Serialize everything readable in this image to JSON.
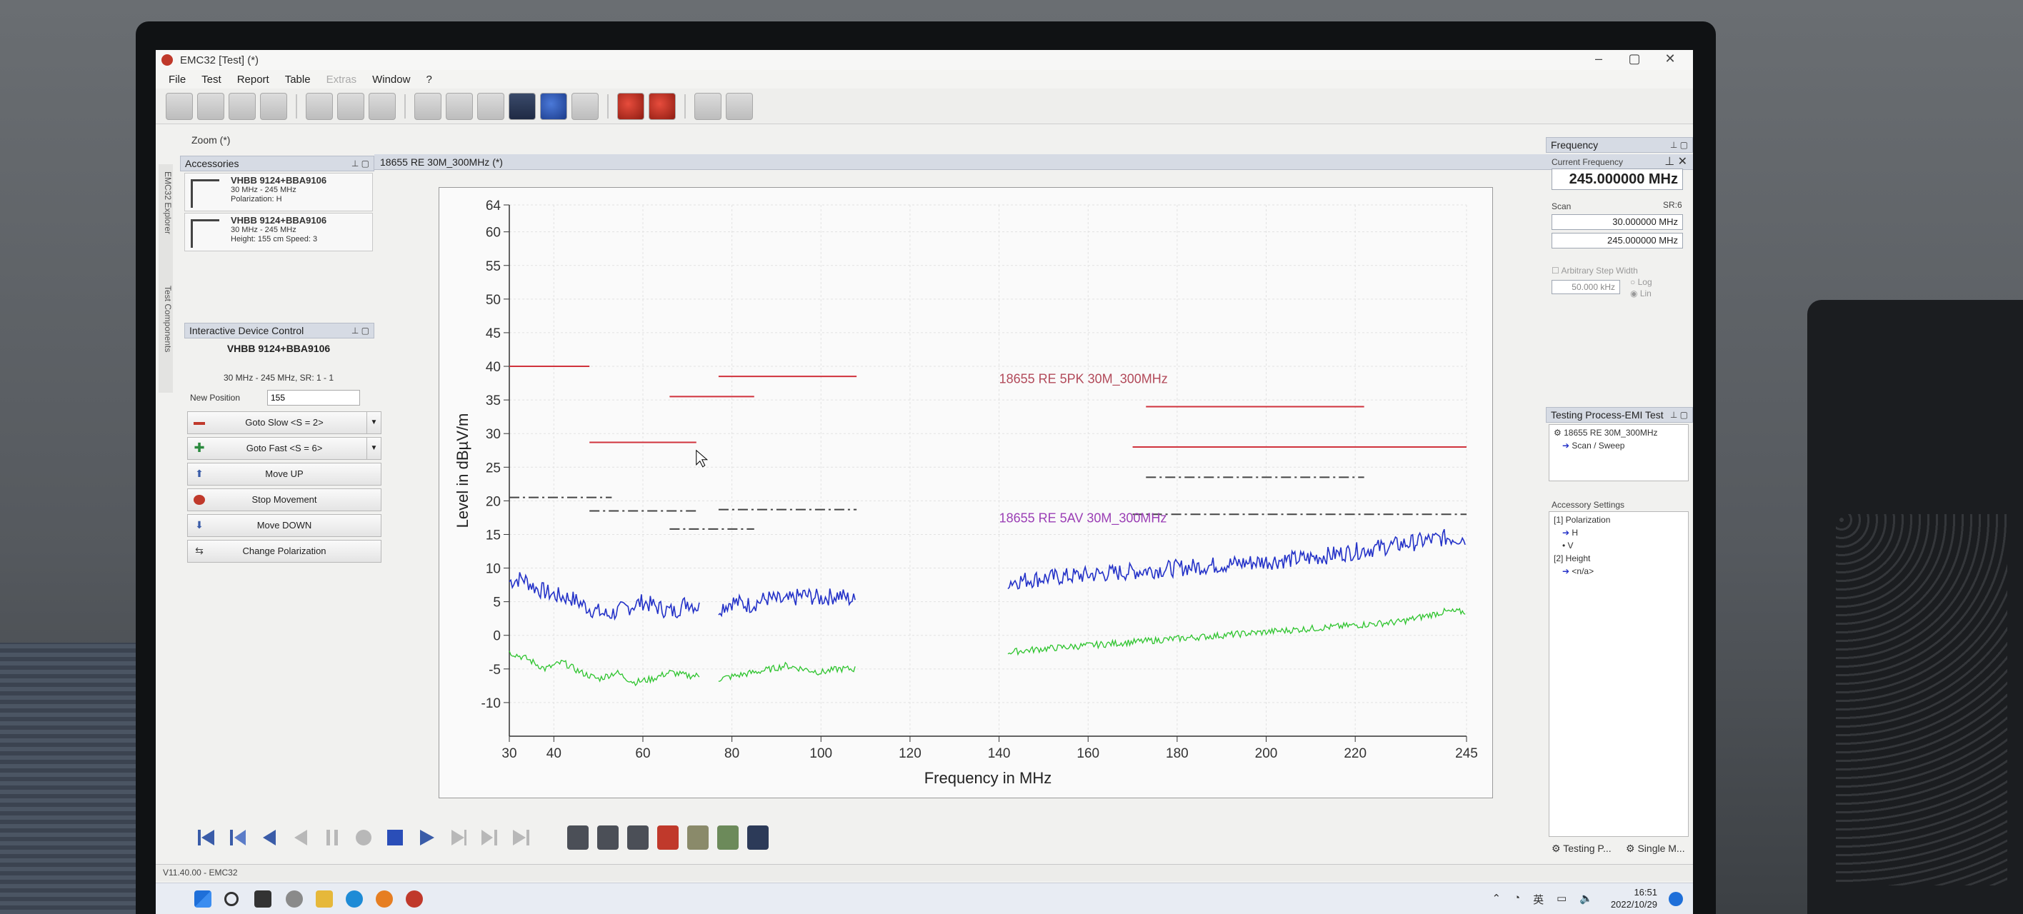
{
  "window": {
    "title": "EMC32 [Test] (*)",
    "menu": [
      "File",
      "Test",
      "Report",
      "Table",
      "Extras",
      "Window",
      "?"
    ]
  },
  "left": {
    "zoom_label": "Zoom (*)",
    "accessories_header": "Accessories",
    "accessories": [
      {
        "name": "VHBB 9124+BBA9106",
        "range": "30 MHz - 245 MHz",
        "detail": "Polarization: H"
      },
      {
        "name": "VHBB 9124+BBA9106",
        "range": "30 MHz - 245 MHz",
        "detail": "Height: 155 cm Speed: 3"
      }
    ],
    "vertical_tabs": [
      "EMC32 Explorer",
      "Test Components"
    ],
    "idc": {
      "header": "Interactive Device Control",
      "device": "VHBB 9124+BBA9106",
      "range": "30 MHz - 245 MHz, SR: 1 - 1",
      "position_label": "New Position",
      "position_value": "155",
      "buttons": [
        "Goto Slow <S = 2>",
        "Goto Fast <S = 6>",
        "Move UP",
        "Stop Movement",
        "Move DOWN",
        "Change Polarization"
      ]
    }
  },
  "doc": {
    "tab_title": "18655 RE 30M_300MHz (*)"
  },
  "chart_data": {
    "type": "line",
    "xlabel": "Frequency in MHz",
    "ylabel": "Level in dBµV/m",
    "xlim": [
      30,
      245
    ],
    "ylim": [
      -15,
      64
    ],
    "x_ticks": [
      30,
      40,
      60,
      80,
      100,
      120,
      140,
      160,
      180,
      200,
      220,
      245
    ],
    "y_ticks": [
      64,
      60,
      55,
      50,
      45,
      40,
      35,
      30,
      25,
      20,
      15,
      10,
      5,
      0,
      -5,
      -10
    ],
    "annotations": [
      "18655 RE 5PK 30M_300MHz",
      "18655 RE 5AV 30M_300MHz"
    ],
    "limit_lines": [
      {
        "style": "solid",
        "color": "#d0323c",
        "segments": [
          [
            30,
            48,
            40
          ],
          [
            48,
            72,
            28.7
          ],
          [
            66,
            85,
            35.5
          ],
          [
            77,
            108,
            38.5
          ],
          [
            173,
            222,
            34
          ],
          [
            170,
            245,
            28
          ]
        ]
      },
      {
        "style": "dashdot",
        "color": "#444444",
        "segments": [
          [
            30,
            53,
            20.5
          ],
          [
            48,
            72,
            18.5
          ],
          [
            66,
            85,
            15.8
          ],
          [
            77,
            108,
            18.7
          ],
          [
            173,
            222,
            23.5
          ],
          [
            170,
            245,
            18
          ]
        ]
      }
    ],
    "series": [
      {
        "color": "#2432c8",
        "segments": [
          {
            "x": [
              30,
              33,
              36,
              40,
              44,
              48,
              52,
              56,
              60,
              64,
              67,
              70,
              73
            ],
            "y": [
              8,
              8.5,
              7,
              6,
              5.5,
              4,
              3,
              4,
              5,
              4,
              3.5,
              5,
              4
            ]
          },
          {
            "x": [
              77,
              80,
              84,
              88,
              92,
              96,
              100,
              104,
              108
            ],
            "y": [
              4,
              5,
              4.5,
              5.5,
              5,
              6,
              5.5,
              6,
              5
            ]
          },
          {
            "x": [
              142,
              150,
              160,
              170,
              180,
              190,
              200,
              210,
              220,
              230,
              240,
              245
            ],
            "y": [
              8,
              8.5,
              9,
              9.5,
              10,
              10.5,
              11,
              11.5,
              12.5,
              13.5,
              14.5,
              14.5
            ]
          }
        ]
      },
      {
        "color": "#2ec42e",
        "segments": [
          {
            "x": [
              30,
              34,
              38,
              42,
              46,
              50,
              54,
              58,
              62,
              66,
              70,
              73
            ],
            "y": [
              -2.5,
              -3.5,
              -5,
              -4,
              -5.5,
              -6.5,
              -5.5,
              -7,
              -6.5,
              -5.5,
              -6,
              -6
            ]
          },
          {
            "x": [
              77,
              81,
              85,
              89,
              92,
              96,
              100,
              104,
              108
            ],
            "y": [
              -6.5,
              -6,
              -5.5,
              -5,
              -4.5,
              -5,
              -5.5,
              -5,
              -5
            ]
          },
          {
            "x": [
              142,
              150,
              160,
              170,
              180,
              190,
              200,
              210,
              220,
              230,
              240,
              245
            ],
            "y": [
              -2.5,
              -2,
              -1.5,
              -1,
              -0.5,
              0,
              0.5,
              1,
              1.5,
              2,
              3.5,
              3.5
            ]
          }
        ]
      }
    ]
  },
  "right": {
    "frequency_header": "Frequency",
    "current_label": "Current Frequency",
    "current_value": "245.000000  MHz",
    "scan_label": "Scan",
    "sr_label": "SR:6",
    "scan_start": "30.000000   MHz",
    "scan_stop": "245.000000   MHz",
    "arb_label": "Arbitrary Step Width",
    "step_value": "50.000  kHz",
    "log_label": "Log",
    "lin_label": "Lin",
    "tp_header": "Testing Process-EMI Test",
    "tp_items": [
      "18655 RE 30M_300MHz",
      "Scan / Sweep"
    ],
    "acc_settings_label": "Accessory Settings",
    "acc_tree": [
      "[1] Polarization",
      "H",
      "V",
      "[2] Height",
      "<n/a>"
    ],
    "bottom_tabs": [
      "Testing P...",
      "Single M..."
    ]
  },
  "status": {
    "version": "V11.40.00 - EMC32"
  },
  "taskbar": {
    "time": "16:51",
    "date": "2022/10/29",
    "ime": "英"
  }
}
